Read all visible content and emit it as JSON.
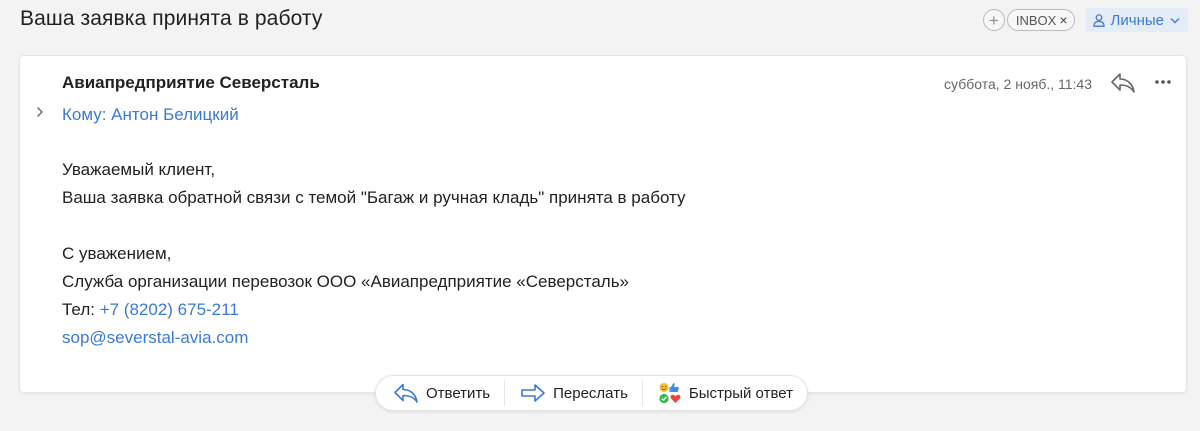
{
  "subject": "Ваша заявка принята в работу",
  "tags": {
    "add_symbol": "+",
    "folder_label": "INBOX",
    "folder_remove": "×",
    "category_label": "Личные"
  },
  "message": {
    "sender": "Авиапредприятие Северсталь",
    "recipient": "Кому: Антон Белицкий",
    "datetime": "суббота, 2 нояб., 11:43",
    "greeting": "Уважаемый клиент,",
    "body_line": "Ваша заявка обратной связи с темой \"Багаж и ручная кладь\" принята в работу",
    "regards": "С уважением,",
    "signature": "Служба организации перевозок ООО «Авиапредприятие «Северсталь»",
    "phone_label": "Тел: ",
    "phone": "+7 (8202) 675-211",
    "email": "sop@severstal-avia.com"
  },
  "actions": {
    "reply": "Ответить",
    "forward": "Переслать",
    "quick_reply": "Быстрый ответ"
  },
  "icons": {
    "expand": "chevron-right-icon",
    "reply": "reply-arrow-icon",
    "more": "more-dots-icon",
    "person": "person-icon",
    "chevron_down": "chevron-down-icon",
    "forward": "forward-arrow-icon",
    "quick_reply": "emoji-reactions-icon"
  },
  "colors": {
    "accent": "#3a7ad4",
    "background": "#f3f3f4",
    "card": "#ffffff"
  }
}
